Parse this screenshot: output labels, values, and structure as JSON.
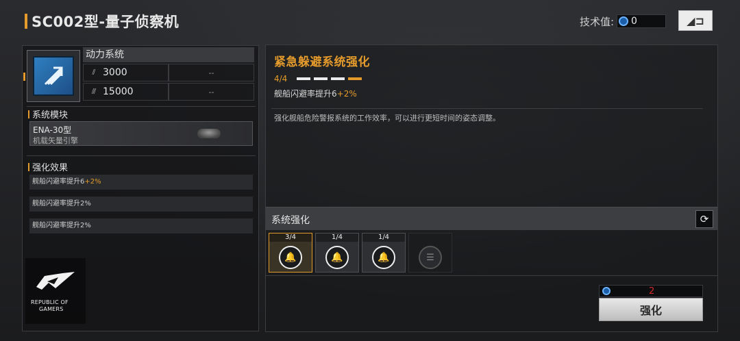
{
  "header": {
    "title": "SC002型-量子侦察机",
    "tech_label": "技术值:",
    "tech_value": "0",
    "back_icon": "back-arrow-icon"
  },
  "system": {
    "name": "动力系统",
    "icon": "speed-boost-icon",
    "stats": [
      {
        "icon": "thrust-icon",
        "value": "3000",
        "next": "--"
      },
      {
        "icon": "boost-icon",
        "value": "15000",
        "next": "--"
      }
    ]
  },
  "module": {
    "section_title": "系统模块",
    "name": "ENA-30型",
    "desc": "机载矢量引擎"
  },
  "effects": {
    "section_title": "强化效果",
    "rows": [
      {
        "text": "舰船闪避率提升6",
        "bonus": "+2%"
      },
      {
        "text": "舰船闪避率提升2%",
        "bonus": ""
      },
      {
        "text": "舰船闪避率提升2%",
        "bonus": ""
      }
    ]
  },
  "branding": {
    "line1": "REPUBLIC OF",
    "line2": "GAMERS"
  },
  "upgrade": {
    "title": "紧急躲避系统强化",
    "progress_text": "4/4",
    "progress": 1.0,
    "effect_text": "舰船闪避率提升6",
    "effect_bonus": "+2%",
    "description": "强化舰船危险警报系统的工作效率，可以进行更短时间的姿态调整。"
  },
  "enhance": {
    "label": "系统强化",
    "refresh_icon": "refresh-icon",
    "slots": [
      {
        "count": "3/4",
        "icon": "alarm-bell-icon",
        "selected": true
      },
      {
        "count": "1/4",
        "icon": "alarm-bell-icon",
        "selected": false
      },
      {
        "count": "1/4",
        "icon": "alarm-bell-icon",
        "selected": false
      },
      {
        "count": "",
        "icon": "locked-slot-icon",
        "selected": false
      }
    ],
    "cost": "2",
    "button_label": "强化"
  },
  "colors": {
    "accent": "#e59b2b",
    "cost_red": "#d42a2a",
    "gem_blue": "#1c5fa8"
  }
}
